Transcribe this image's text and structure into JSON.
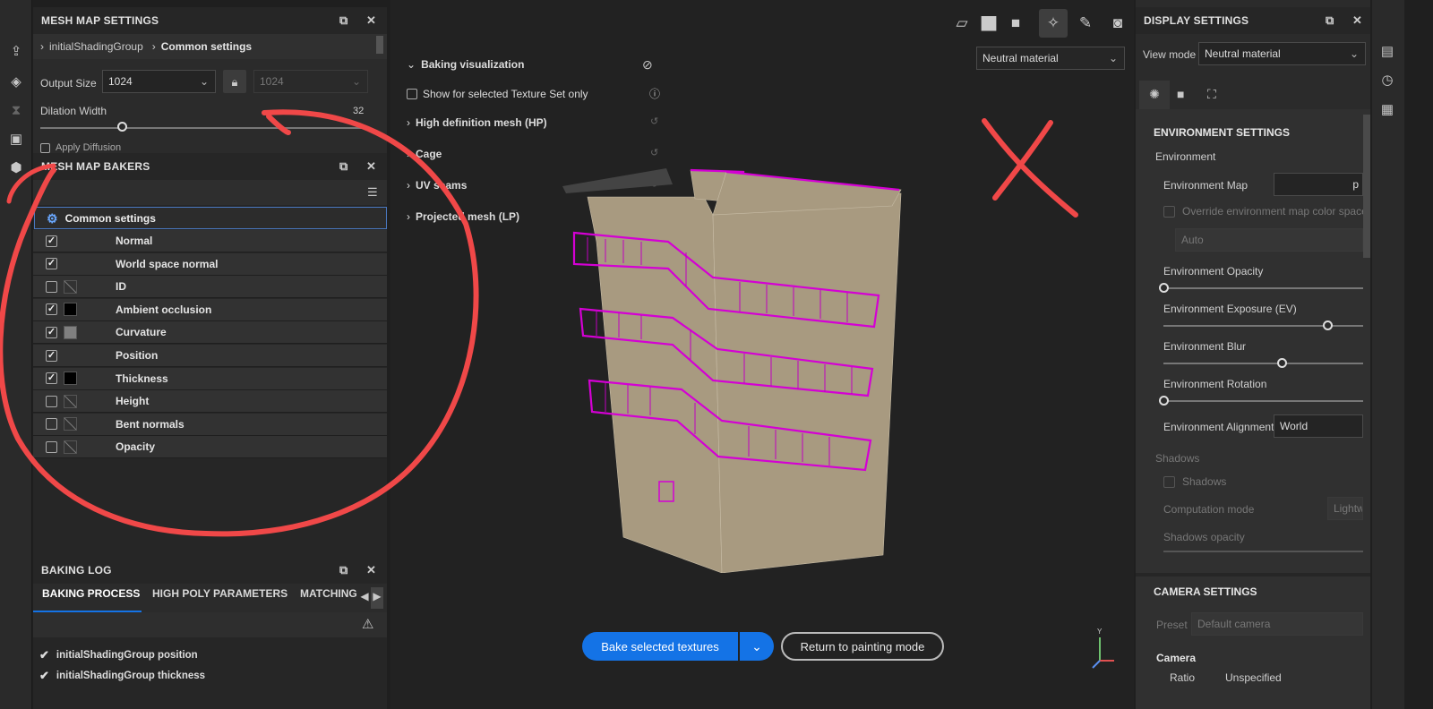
{
  "mesh_map_settings": {
    "title": "MESH MAP SETTINGS",
    "breadcrumb": [
      "initialShadingGroup",
      "Common settings"
    ],
    "output_size_label": "Output Size",
    "output_size_value": "1024",
    "output_size_locked_value": "1024",
    "dilation_width_label": "Dilation Width",
    "dilation_width_value": "32",
    "dilation_fraction": 0.25,
    "cut_option_label": "Apply Diffusion"
  },
  "mesh_map_bakers": {
    "title": "MESH MAP BAKERS",
    "common_settings_label": "Common settings",
    "items": [
      {
        "label": "Normal",
        "checked": true,
        "swatch": "none"
      },
      {
        "label": "World space normal",
        "checked": true,
        "swatch": "none"
      },
      {
        "label": "ID",
        "checked": false,
        "swatch": "slash"
      },
      {
        "label": "Ambient occlusion",
        "checked": true,
        "swatch": "#000000"
      },
      {
        "label": "Curvature",
        "checked": true,
        "swatch": "#808080"
      },
      {
        "label": "Position",
        "checked": true,
        "swatch": "none"
      },
      {
        "label": "Thickness",
        "checked": true,
        "swatch": "#000000"
      },
      {
        "label": "Height",
        "checked": false,
        "swatch": "slash"
      },
      {
        "label": "Bent normals",
        "checked": false,
        "swatch": "slash"
      },
      {
        "label": "Opacity",
        "checked": false,
        "swatch": "slash"
      }
    ]
  },
  "baking_log": {
    "title": "BAKING LOG",
    "tabs": [
      "BAKING PROCESS",
      "HIGH POLY PARAMETERS",
      "MATCHING"
    ],
    "entries": [
      "initialShadingGroup position",
      "initialShadingGroup thickness"
    ]
  },
  "viewport": {
    "material_dropdown": "Neutral material",
    "sections": [
      {
        "label": "Baking visualization",
        "expanded": true
      },
      {
        "label": "Show for selected Texture Set only",
        "type": "checkbox"
      },
      {
        "label": "High definition mesh (HP)"
      },
      {
        "label": "Cage"
      },
      {
        "label": "UV seams"
      },
      {
        "label": "Projected mesh (LP)"
      }
    ],
    "bake_button": "Bake selected textures",
    "return_button": "Return to painting mode",
    "axis_label": "Y"
  },
  "display_settings": {
    "title": "DISPLAY SETTINGS",
    "view_mode_label": "View mode",
    "view_mode_value": "Neutral material",
    "env_header": "ENVIRONMENT SETTINGS",
    "env_sub": "Environment",
    "env_map_label": "Environment Map",
    "env_map_value": "p",
    "override_label": "Override environment map color space",
    "auto_value": "Auto",
    "opacity_label": "Environment Opacity",
    "opacity_fraction": 0.0,
    "exposure_label": "Environment Exposure (EV)",
    "exposure_fraction": 0.82,
    "blur_label": "Environment Blur",
    "blur_fraction": 0.59,
    "rotation_label": "Environment Rotation",
    "rotation_fraction": 0.0,
    "alignment_label": "Environment Alignment",
    "alignment_value": "World",
    "shadows_header": "Shadows",
    "shadows_checkbox": "Shadows",
    "computation_label": "Computation mode",
    "computation_value": "Lightw",
    "shadows_opacity_label": "Shadows opacity",
    "camera_header": "CAMERA SETTINGS",
    "preset_label": "Preset",
    "preset_value": "Default camera",
    "camera_sub": "Camera",
    "ratio_label": "Ratio",
    "ratio_value": "Unspecified"
  },
  "colors": {
    "accent": "#1473e6",
    "annotation": "#f04848",
    "wire": "#d400d4",
    "building": "#a89a80"
  }
}
